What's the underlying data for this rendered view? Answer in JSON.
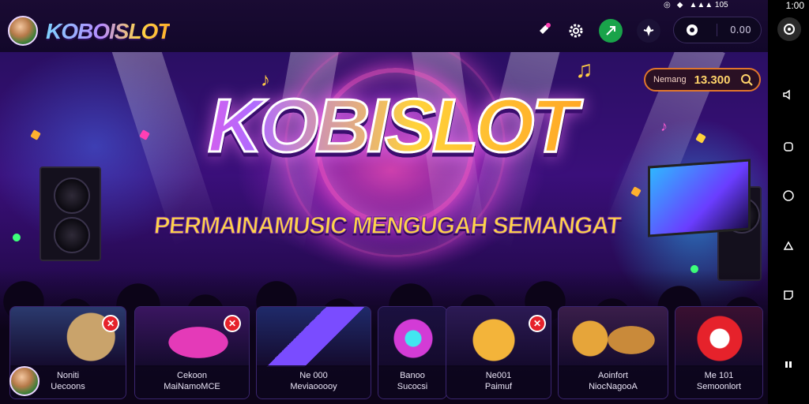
{
  "app": {
    "brand_name": "KOBOISLOT"
  },
  "status_bar": {
    "time": "1:00",
    "signal": "▲▲▲ 105"
  },
  "toolbar": {
    "balance_value": "0.00"
  },
  "hero": {
    "title": "KOBISLOT",
    "subtitle": "PERMAINAMUSIC MENGUGAH SEMANGAT",
    "search_label": "Nemang",
    "search_value": "13.300"
  },
  "cards": [
    {
      "line1": "Noniti",
      "line2": "Uecoons",
      "has_badge": true
    },
    {
      "line1": "Cekoon",
      "line2": "MaiNamoMCE",
      "has_badge": true
    },
    {
      "line1": "Ne 000",
      "line2": "Meviaooooy",
      "has_badge": false
    },
    {
      "line1": "Banoo",
      "line2": "Sucocsi",
      "has_badge": false
    },
    {
      "line1": "Ne001",
      "line2": "Paimuf",
      "has_badge": true
    },
    {
      "line1": "Aoinfort",
      "line2": "NiocNagooA",
      "has_badge": false
    },
    {
      "line1": "Me 101",
      "line2": "Semoonlort",
      "has_badge": false
    }
  ],
  "colors": {
    "accent_gold": "#ffd23a",
    "accent_pink": "#ff4fd8",
    "accent_purple": "#b06bff",
    "danger": "#e6222b",
    "success": "#19a34a"
  },
  "icons": [
    "rocket-icon",
    "gear-icon",
    "arrow-icon",
    "badge-icon",
    "cog-icon",
    "search-icon",
    "refresh-icon",
    "volume-icon",
    "home-icon",
    "circle-icon",
    "share-icon",
    "back-icon",
    "pause-icon"
  ]
}
